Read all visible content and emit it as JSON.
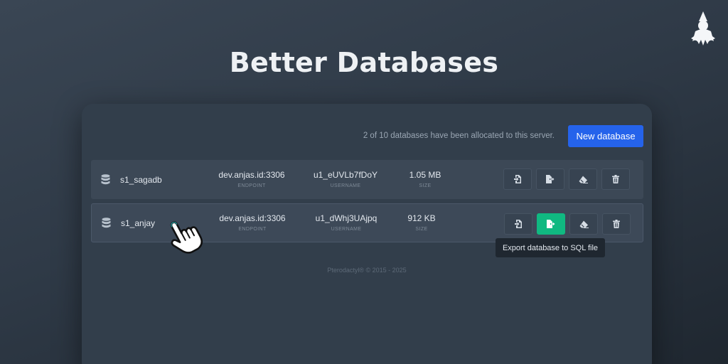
{
  "header": {
    "title": "Better Databases"
  },
  "logo": {
    "icon": "pterodactyl-logo"
  },
  "toolbar": {
    "allocation_text": "2 of 10 databases have been allocated to this server.",
    "new_database_label": "New database"
  },
  "labels": {
    "endpoint": "ENDPOINT",
    "username": "USERNAME",
    "size": "SIZE"
  },
  "databases": [
    {
      "name": "s1_sagadb",
      "endpoint": "dev.anjas.id:3306",
      "username": "u1_eUVLb7fDoY",
      "size": "1.05 MB"
    },
    {
      "name": "s1_anjay",
      "endpoint": "dev.anjas.id:3306",
      "username": "u1_dWhj3UAjpq",
      "size": "912 KB"
    }
  ],
  "actions": [
    "import-icon",
    "export-icon",
    "eraser-icon",
    "trash-icon"
  ],
  "tooltip": {
    "text": "Export database to SQL file"
  },
  "footer": {
    "text": "Pterodactyl® © 2015 - 2025"
  },
  "colors": {
    "accent": "#2563eb",
    "success": "#10b981",
    "panel": "#323e4b",
    "row": "#3c4856"
  }
}
